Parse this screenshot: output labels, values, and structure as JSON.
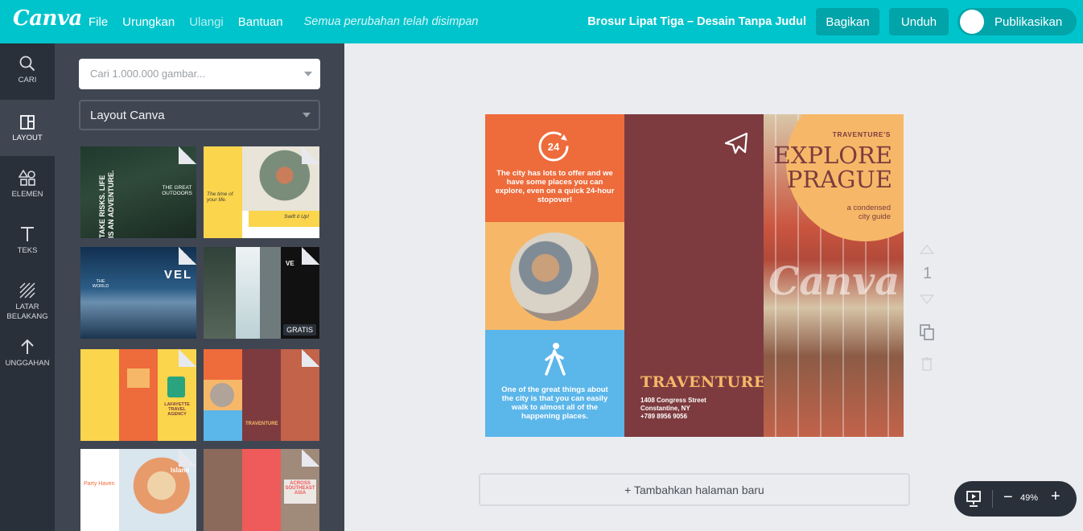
{
  "topbar": {
    "logo": "Canva",
    "menu": {
      "file": "File",
      "undo": "Urungkan",
      "redo": "Ulangi",
      "help": "Bantuan",
      "status": "Semua perubahan telah disimpan"
    },
    "doc_title": "Brosur Lipat Tiga – Desain Tanpa Judul",
    "share": "Bagikan",
    "download": "Unduh",
    "publish": "Publikasikan",
    "bg_color": "#00c4cc",
    "button_color": "#01a4a9"
  },
  "leftnav": {
    "items": [
      {
        "label": "CARI",
        "icon": "search-icon"
      },
      {
        "label": "LAYOUT",
        "icon": "layout-icon"
      },
      {
        "label": "ELEMEN",
        "icon": "shapes-icon"
      },
      {
        "label": "TEKS",
        "icon": "text-icon"
      },
      {
        "label": "LATAR BELAKANG",
        "icon": "background-icon"
      },
      {
        "label": "UNGGAHAN",
        "icon": "upload-icon"
      }
    ],
    "active": "LAYOUT"
  },
  "panel": {
    "search_placeholder": "Cari 1.000.000 gambar...",
    "layout_select": "Layout Canva",
    "thumbs": [
      {
        "text_1": "TAKE RISKS. LIFE IS AN ADVENTURE.",
        "text_2": "THE GREAT OUTDOORS"
      },
      {
        "text_1": "The time of your life.",
        "text_2": "Swift it Up!"
      },
      {
        "text_1": "THE WORLD",
        "text_2": "VEL"
      },
      {
        "text_1": "VE",
        "badge": "GRATIS"
      },
      {
        "text_1": "LAFAYETTE TRAVEL AGENCY"
      },
      {
        "text_1": "TRAVENTURE"
      },
      {
        "text_1": "Party Haven",
        "text_2": "Island"
      },
      {
        "text_1": "ACROSS SOUTHEAST ASIA"
      }
    ]
  },
  "brochure": {
    "panel1_top_text": "The city has lots to offer and we have some places you can explore, even on a quick 24-hour stopover!",
    "panel1_bottom_text": "One of the great things about the city is that you can easily walk to almost all of the happening places.",
    "badge_24": "24",
    "brand": "TRAVENTURE",
    "address": [
      "1408 Congress Street",
      "Constantine, NY",
      "+789 8956 9056"
    ],
    "cover_pre": "TRAVENTURE'S",
    "cover_title_1": "EXPLORE",
    "cover_title_2": "PRAGUE",
    "cover_sub": "a condensed city guide",
    "watermark": "Canva",
    "colors": {
      "orange": "#ee6b3b",
      "peach": "#f6b868",
      "blue": "#5bb6ea",
      "maroon": "#7d3b3f"
    }
  },
  "page_controls": {
    "page_number": "1"
  },
  "add_page": "+ Tambahkan halaman baru",
  "zoom": {
    "minus": "−",
    "value": "49%",
    "plus": "+"
  }
}
